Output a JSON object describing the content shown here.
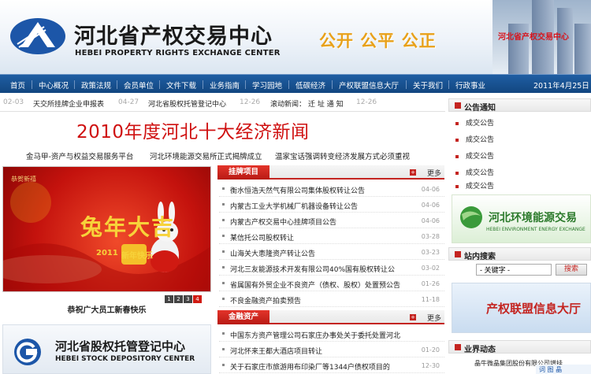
{
  "header": {
    "logo_cn": "河北省产权交易中心",
    "logo_en": "HEBEI PROPERTY RIGHTS EXCHANGE CENTER",
    "slogan": "公开  公平  公正",
    "building_text": "河北省产权交易中心"
  },
  "nav": {
    "items": [
      "首页",
      "中心概况",
      "政策法规",
      "会员单位",
      "文件下载",
      "业务指南",
      "学习园地",
      "低碳经济",
      "产权联盟信息大厅",
      "关于我们",
      "行政事业"
    ],
    "date": "2011年4月25日 星"
  },
  "ticker": {
    "items": [
      {
        "date": "02-03",
        "text": "天交所挂牌企业申报表"
      },
      {
        "date": "04-27",
        "text": "河北省股权托管登记中心"
      },
      {
        "date": "12-26",
        "text": ""
      }
    ],
    "scroll_label": "滚动新闻：",
    "scroll_text": "迁 址 通 知",
    "scroll_date": "12-26"
  },
  "headline": "2010年度河北十大经济新闻",
  "sub_links": [
    "金马甲-资产与权益交易服务平台",
    "河北环境能源交易所正式揭牌成立",
    "温家宝话强调转变经济发展方式必须重视"
  ],
  "photo": {
    "caption": "恭祝广大员工新春快乐",
    "pages": [
      "1",
      "2",
      "3",
      "4"
    ],
    "active_page": 4,
    "art_text": "兔年大吉",
    "art_sub": "新年快乐",
    "art_year": "2011",
    "corner_text": "恭贺新禧"
  },
  "equity_banner": {
    "cn": "河北省股权托管登记中心",
    "en": "HEBEI STOCK DEPOSITORY CENTER"
  },
  "listing": {
    "tab": "挂牌项目",
    "more": "更多",
    "rows": [
      {
        "title": "衡水恒浩天然气有限公司集体股权转让公告",
        "date": "04-06"
      },
      {
        "title": "内蒙古工业大学机械厂机器设备转让公告",
        "date": "04-06"
      },
      {
        "title": "内蒙古产权交易中心挂牌项目公告",
        "date": "04-06"
      },
      {
        "title": "某信托公司股权转让",
        "date": "03-28"
      },
      {
        "title": "山海关大恵隆资产转让公告",
        "date": "03-23"
      },
      {
        "title": "河北三友能源技术开发有限公司40%国有股权转让公",
        "date": "03-02"
      },
      {
        "title": "省属国有外贸企业不良资产（债权、股权）处置预公告",
        "date": "01-26"
      },
      {
        "title": "不良金融资产拍卖预告",
        "date": "11-18"
      }
    ]
  },
  "finance": {
    "tab": "金融资产",
    "more": "更多",
    "rows": [
      {
        "title": "中国东方资产管理公司石家庄办事处关于委托处置河北",
        "date": ""
      },
      {
        "title": "河北怀来王都大酒店项目转让",
        "date": "01-20"
      },
      {
        "title": "关于石家庄市旅游用布印染厂等1344户债权项目的",
        "date": "12-30"
      }
    ]
  },
  "notices": {
    "title": "公告通知",
    "items": [
      "成交公告",
      "成交公告",
      "成交公告",
      "成交公告",
      "成交公告"
    ]
  },
  "energy_banner": {
    "cn": "河北环境能源交易",
    "en": "HEBEI ENVIRONMENT ENERGY EXCHANGE"
  },
  "search": {
    "title": "站内搜索",
    "value": "- 关键字 -",
    "button": "搜索"
  },
  "alliance_banner": "产权联盟信息大厅",
  "biz": {
    "title": "业界动态",
    "text": "晶牛微晶集团股份有限公司增挂"
  },
  "float": {
    "text": "词 图 晶"
  }
}
